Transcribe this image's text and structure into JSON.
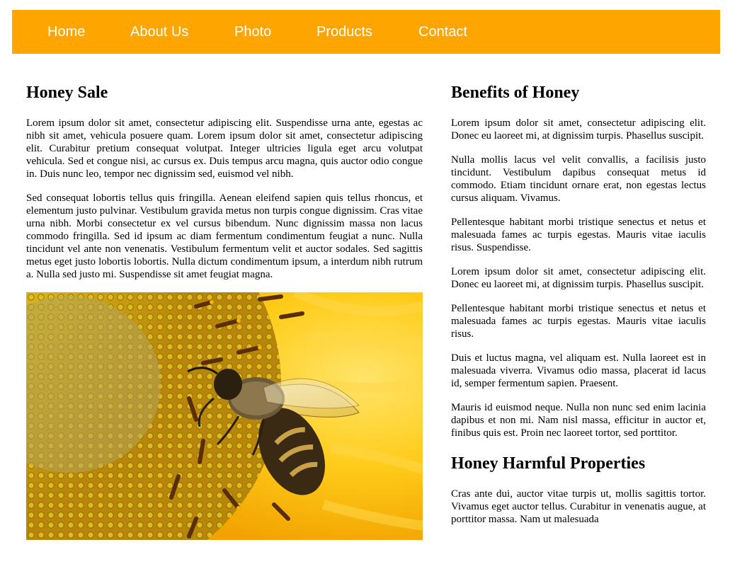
{
  "nav": {
    "items": [
      {
        "label": "Home"
      },
      {
        "label": "About Us"
      },
      {
        "label": "Photo"
      },
      {
        "label": "Products"
      },
      {
        "label": "Contact"
      }
    ]
  },
  "colors": {
    "nav_background": "#ffa500",
    "nav_text": "#ffffff"
  },
  "left": {
    "title": "Honey Sale",
    "paragraphs": [
      "Lorem ipsum dolor sit amet, consectetur adipiscing elit. Suspendisse urna ante, egestas ac nibh sit amet, vehicula posuere quam. Lorem ipsum dolor sit amet, consectetur adipiscing elit. Curabitur pretium consequat volutpat. Integer ultricies ligula eget arcu volutpat vehicula. Sed et congue nisi, ac cursus ex. Duis tempus arcu magna, quis auctor odio congue in. Duis nunc leo, tempor nec dignissim sed, euismod vel nibh.",
      "Sed consequat lobortis tellus quis fringilla. Aenean eleifend sapien quis tellus rhoncus, et elementum justo pulvinar. Vestibulum gravida metus non turpis congue dignissim. Cras vitae urna nibh. Morbi consectetur ex vel cursus bibendum. Nunc dignissim massa non lacus commodo fringilla. Sed id ipsum ac diam fermentum condimentum feugiat a nunc. Nulla tincidunt vel ante non venenatis. Vestibulum fermentum velit et auctor sodales. Sed sagittis metus eget justo lobortis lobortis. Nulla dictum condimentum ipsum, a interdum nibh rutrum a. Nulla sed justo mi. Suspendisse sit amet feugiat magna."
    ],
    "image_subject": "bee-on-sunflower"
  },
  "right": {
    "title": "Benefits of Honey",
    "paragraphs": [
      "Lorem ipsum dolor sit amet, consectetur adipiscing elit. Donec eu laoreet mi, at dignissim turpis. Phasellus suscipit.",
      "Nulla mollis lacus vel velit convallis, a facilisis justo tincidunt. Vestibulum dapibus consequat metus id commodo. Etiam tincidunt ornare erat, non egestas lectus cursus aliquam. Vivamus.",
      "Pellentesque habitant morbi tristique senectus et netus et malesuada fames ac turpis egestas. Mauris vitae iaculis risus. Suspendisse.",
      "Lorem ipsum dolor sit amet, consectetur adipiscing elit. Donec eu laoreet mi, at dignissim turpis. Phasellus suscipit.",
      "Pellentesque habitant morbi tristique senectus et netus et malesuada fames ac turpis egestas. Mauris vitae iaculis risus.",
      "Duis et luctus magna, vel aliquam est. Nulla laoreet est in malesuada viverra. Vivamus odio massa, placerat id lacus id, semper fermentum sapien. Praesent.",
      "Mauris id euismod neque. Nulla non nunc sed enim lacinia dapibus et non mi. Nam nisl massa, efficitur in auctor et, finibus quis est. Proin nec laoreet tortor, sed porttitor."
    ],
    "title2": "Honey Harmful Properties",
    "paragraphs2": [
      "Cras ante dui, auctor vitae turpis ut, mollis sagittis tortor. Vivamus eget auctor tellus. Curabitur in venenatis augue, at porttitor massa. Nam ut malesuada"
    ]
  }
}
